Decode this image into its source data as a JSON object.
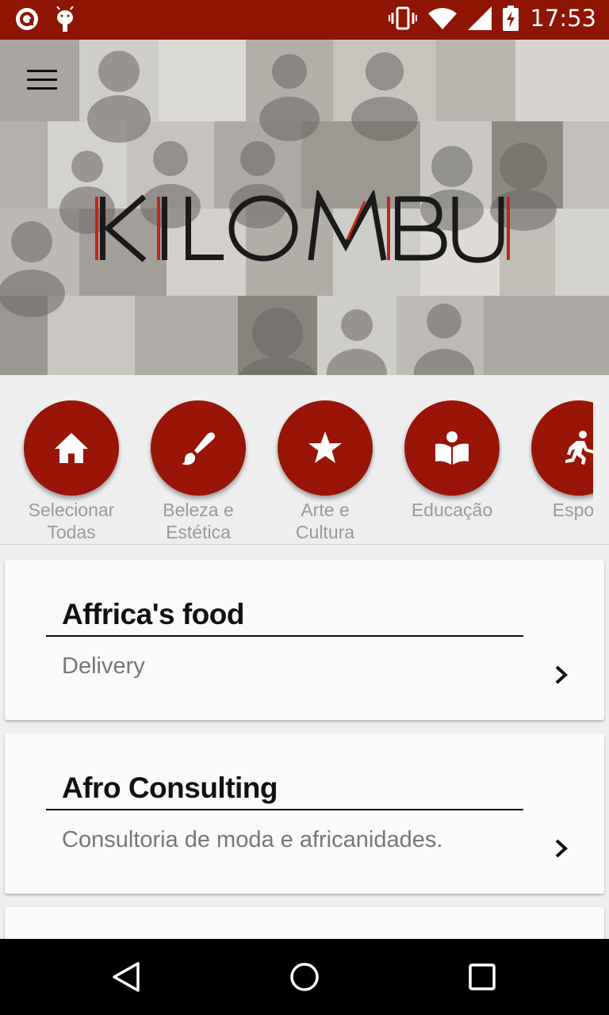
{
  "status_bar": {
    "time": "17:53",
    "icons": [
      "notification-icon",
      "android-debug-icon",
      "vibrate-icon",
      "wifi-icon",
      "signal-icon",
      "battery-charging-icon"
    ]
  },
  "header": {
    "logo_text": "KILOMBU",
    "menu_icon": "hamburger-icon"
  },
  "categories": [
    {
      "label": "Selecionar\nTodas",
      "icon": "home-icon"
    },
    {
      "label": "Beleza e\nEstética",
      "icon": "brush-icon"
    },
    {
      "label": "Arte e\nCultura",
      "icon": "star-icon"
    },
    {
      "label": "Educação",
      "icon": "book-reader-icon"
    },
    {
      "label": "Esport",
      "icon": "running-icon"
    }
  ],
  "listings": [
    {
      "title": "Affrica's food",
      "subtitle": "Delivery"
    },
    {
      "title": "Afro Consulting",
      "subtitle": "Consultoria de moda e africanidades."
    }
  ],
  "colors": {
    "primary": "#981507",
    "status_bar": "#8f1505",
    "background": "#eeeeee"
  },
  "navigation": [
    "back-icon",
    "home-circle-icon",
    "recents-icon"
  ]
}
